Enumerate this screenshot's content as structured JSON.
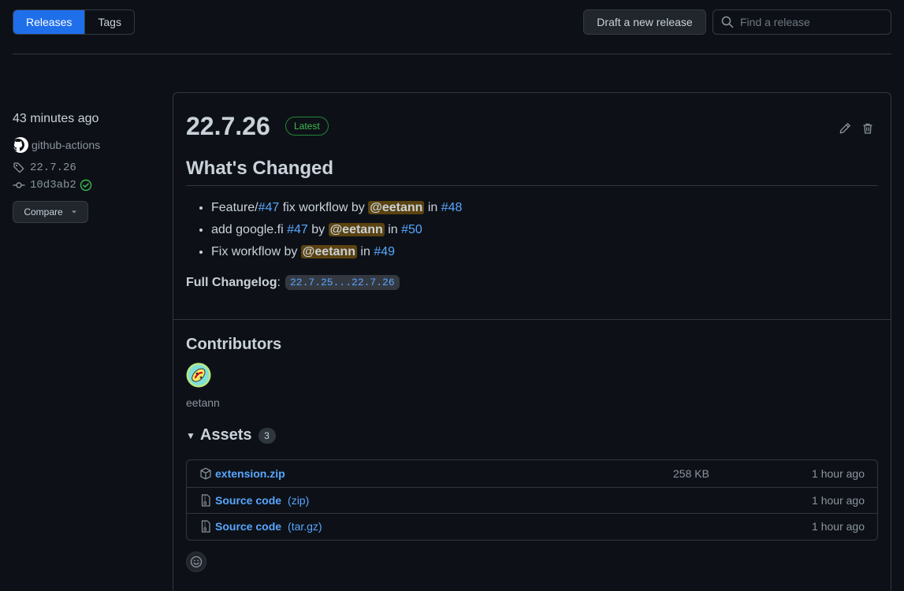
{
  "tabs": [
    {
      "label": "Releases",
      "active": true
    },
    {
      "label": "Tags",
      "active": false
    }
  ],
  "toolbar": {
    "draft_label": "Draft a new release",
    "search_placeholder": "Find a release"
  },
  "meta": {
    "time": "43 minutes ago",
    "author": "github-actions",
    "tag": "22.7.26",
    "commit": "10d3ab2",
    "compare_label": "Compare"
  },
  "release": {
    "title": "22.7.26",
    "badge": "Latest",
    "heading": "What's Changed",
    "changes": [
      {
        "pre": "Feature/",
        "ref": "#47",
        "text": " fix workflow by ",
        "mention": "@eetann",
        "in": " in ",
        "pr": "#48"
      },
      {
        "pre": "add google.fi ",
        "ref": "#47",
        "text": " by ",
        "mention": "@eetann",
        "in": " in ",
        "pr": "#50"
      },
      {
        "pre": "Fix workflow by ",
        "ref": "",
        "text": "",
        "mention": "@eetann",
        "in": " in ",
        "pr": "#49"
      }
    ],
    "changelog_label": "Full Changelog",
    "changelog_colon": ":",
    "changelog_range": "22.7.25...22.7.26"
  },
  "contributors": {
    "title": "Contributors",
    "names": [
      "eetann"
    ]
  },
  "assets": {
    "title": "Assets",
    "count": "3",
    "items": [
      {
        "name": "extension.zip",
        "ext": "",
        "size": "258 KB",
        "time": "1 hour ago",
        "icon": "package-icon"
      },
      {
        "name": "Source code",
        "ext": "(zip)",
        "size": "",
        "time": "1 hour ago",
        "icon": "file-zip-icon"
      },
      {
        "name": "Source code",
        "ext": "(tar.gz)",
        "size": "",
        "time": "1 hour ago",
        "icon": "file-zip-icon"
      }
    ]
  },
  "colors": {
    "background": "#0d1117",
    "accent": "#1f6feb",
    "link": "#58a6ff",
    "success": "#3fb950"
  }
}
